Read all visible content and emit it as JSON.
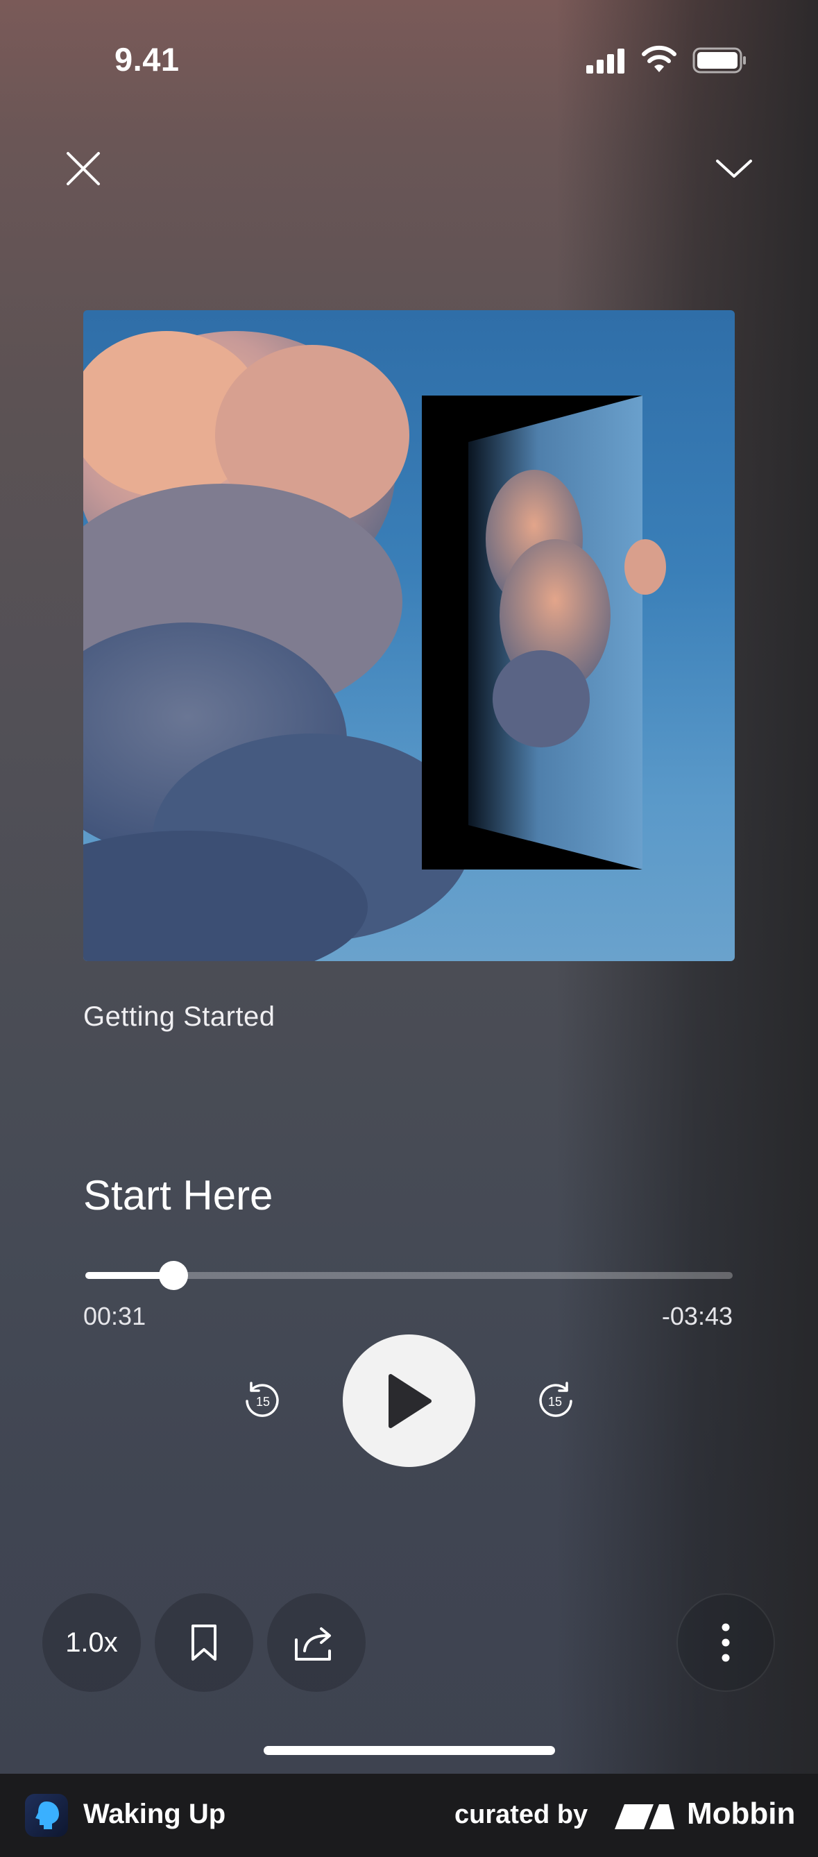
{
  "status_bar": {
    "time": "9.41"
  },
  "player": {
    "series_title": "Getting Started",
    "track_title": "Start Here",
    "progress": 0.136,
    "elapsed": "00:31",
    "remaining": "-03:43",
    "skip_back_seconds": "15",
    "skip_forward_seconds": "15",
    "speed": "1.0x"
  },
  "icons": {
    "close": "close-icon",
    "collapse": "chevron-down-icon",
    "play": "play-icon",
    "bookmark": "bookmark-icon",
    "share": "share-icon",
    "more": "more-vertical-icon"
  },
  "footer": {
    "app_name": "Waking Up",
    "curated_by": "curated by",
    "brand": "Mobbin"
  },
  "colors": {
    "play_button": "#f2f2f2",
    "footer_bg": "#1b1b1d"
  }
}
